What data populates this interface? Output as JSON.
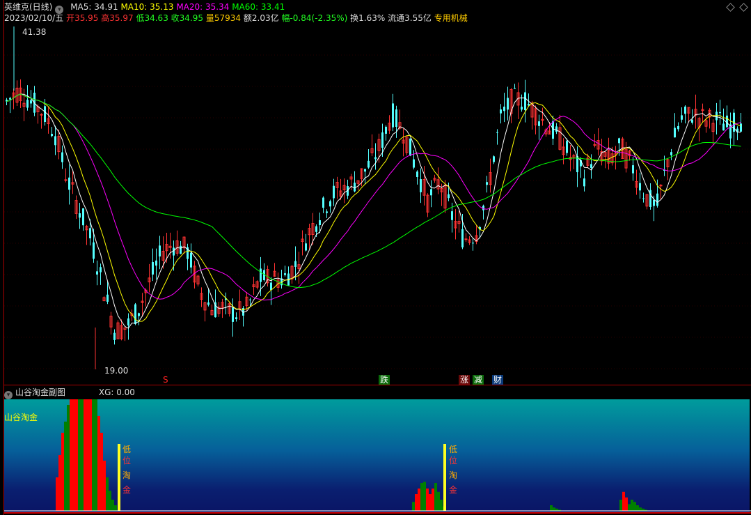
{
  "header": {
    "stock_name": "英维克(日线)",
    "ma5": "MA5: 34.91",
    "ma10": "MA10: 35.13",
    "ma20": "MA20: 35.34",
    "ma60": "MA60: 33.41",
    "date": "2023/02/10/五",
    "open_label": "开",
    "open": "35.95",
    "high_label": "高",
    "high": "35.97",
    "low_label": "低",
    "low": "34.63",
    "close_label": "收",
    "close": "34.95",
    "vol_label": "量",
    "vol": "57934",
    "amount": "额2.03亿",
    "change_label": "幅",
    "change": "-0.84(-2.35%)",
    "turnover": "换1.63%",
    "float": "流通3.55亿",
    "sector": "专用机械"
  },
  "main_chart": {
    "max_label": "41.38",
    "min_label": "19.00",
    "markers": [
      "S",
      "跌",
      "涨",
      "减",
      "财"
    ],
    "price_path": [
      36.5,
      37.2,
      36.5,
      35.8,
      34.5,
      31.5,
      29.5,
      27.5,
      24.5,
      21.5,
      21.8,
      23,
      25,
      26.8,
      27.2,
      26.8,
      24.2,
      23,
      23,
      22.6,
      23,
      24.9,
      24.9,
      24.9,
      25.8,
      27.8,
      29.1,
      30.4,
      30.8,
      31.3,
      32.2,
      33.5,
      35.7,
      34.5,
      32.2,
      30,
      31.3,
      29,
      27.5,
      27.9,
      30.8,
      35.3,
      36.6,
      36.6,
      35.7,
      34.8,
      34,
      32.6,
      31.7,
      33.5,
      32.6,
      33.5,
      32.2,
      30.4,
      29.5,
      32.9,
      35.3,
      35.7,
      35.3,
      35.3,
      34.8,
      35.3
    ]
  },
  "sub_chart": {
    "title": "山谷淘金副图",
    "xg": "XG: 0.00",
    "label": "山谷淘金",
    "signal_chars": [
      "低",
      "位",
      "淘",
      "金"
    ]
  },
  "colors": {
    "up": "#ff3333",
    "down": "#54ffff",
    "ma5": "#ffffff",
    "ma10": "#ffff00",
    "ma20": "#ff00ff",
    "ma60": "#00ff00"
  }
}
